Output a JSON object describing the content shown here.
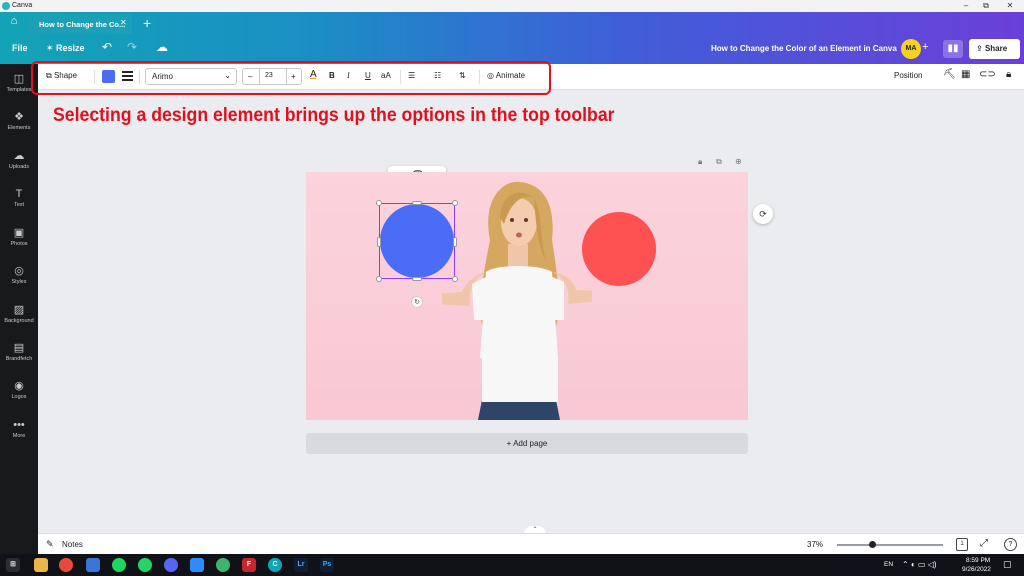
{
  "window": {
    "app_name": "Canva",
    "minimize": "–",
    "maximize": "⧉",
    "close": "✕"
  },
  "tabs": {
    "home_icon": "home-icon",
    "active_tab": "How to Change the Co...",
    "close": "✕",
    "new_tab": "+"
  },
  "header": {
    "file": "File",
    "resize": "Resize",
    "doc_title": "How to Change the Color of an Element in Canva",
    "avatar_initials": "MA",
    "share": "Share"
  },
  "sidebar": {
    "items": [
      {
        "label": "Templates",
        "icon": "templates-icon"
      },
      {
        "label": "Elements",
        "icon": "elements-icon"
      },
      {
        "label": "Uploads",
        "icon": "uploads-icon"
      },
      {
        "label": "Text",
        "icon": "text-icon"
      },
      {
        "label": "Photos",
        "icon": "photos-icon"
      },
      {
        "label": "Styles",
        "icon": "styles-icon"
      },
      {
        "label": "Background",
        "icon": "background-icon"
      },
      {
        "label": "Brandfetch",
        "icon": "brandfetch-icon"
      },
      {
        "label": "Logos",
        "icon": "logos-icon"
      },
      {
        "label": "More",
        "icon": "more-icon"
      }
    ]
  },
  "toolbar": {
    "shape": "Shape",
    "fill_color": "#4a6cf7",
    "font": "Arimo",
    "font_size": "23",
    "minus": "–",
    "plus": "+",
    "bold": "B",
    "italic": "I",
    "underline": "U",
    "case": "aA",
    "animate": "Animate",
    "position": "Position"
  },
  "annotation": "Selecting a design element brings up the options in the top toolbar",
  "canvas": {
    "blue_circle_color": "#4a6cf7",
    "red_circle_color": "#fe5252",
    "add_page": "+ Add page"
  },
  "bottom": {
    "notes": "Notes",
    "zoom": "37%",
    "zoom_level": 0.33,
    "page_count": "1",
    "help": "?"
  },
  "taskbar": {
    "lang": "EN",
    "time": "8:59 PM",
    "date": "9/26/2022",
    "apps": [
      "windows-start-icon",
      "file-explorer-icon",
      "chrome-icon",
      "folder-icon",
      "spotify-icon",
      "whatsapp-icon",
      "discord-icon",
      "zoom-icon",
      "greenapp-icon",
      "filezilla-icon",
      "canva-icon",
      "lightroom-icon",
      "photoshop-icon"
    ]
  }
}
